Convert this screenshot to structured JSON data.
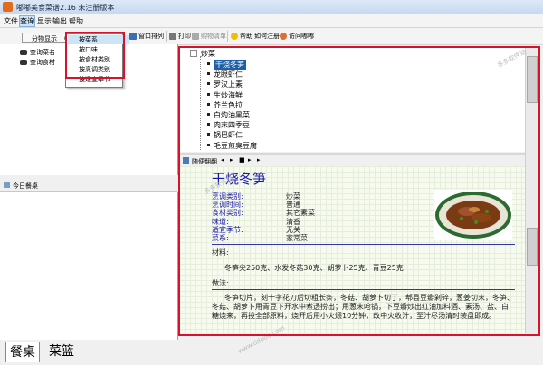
{
  "window": {
    "title": "嘟嘟美食菜谱2.16 未注册版本"
  },
  "menu": {
    "items": [
      "文件",
      "查询",
      "显示",
      "输出",
      "帮助"
    ]
  },
  "query_submenu": {
    "label": "分物显示"
  },
  "dropdown": {
    "items": [
      "按菜系",
      "按口味",
      "按食材类别",
      "按烹调类别",
      "按适宜季节"
    ]
  },
  "toolbar": {
    "window_arrange": "窗口排列",
    "print": "打印",
    "shopping_list": "购物清单",
    "help": "帮助",
    "register": "如何注册",
    "visit": "访问嘟嘟"
  },
  "left_panel": {
    "items": [
      "查询菜名",
      "查询食材"
    ],
    "bottom_title": "今日餐桌"
  },
  "tabs": [
    "餐桌",
    "菜篮"
  ],
  "tree": {
    "root": "炒菜",
    "items": [
      "干烧冬笋",
      "龙眼虾仁",
      "罗汉上素",
      "生炒海鲜",
      "芥兰色拉",
      "白灼油黑菜",
      "肉末四季豆",
      "锅巴虾仁",
      "毛豆煎臭豆腐"
    ],
    "selected_index": 0
  },
  "nav": {
    "label": "随便翻翻"
  },
  "recipe": {
    "name": "干烧冬笋",
    "fields": [
      {
        "label": "烹调类别:",
        "value": "炒菜"
      },
      {
        "label": "烹调时间:",
        "value": "普通"
      },
      {
        "label": "食材类别:",
        "value": "其它素菜"
      },
      {
        "label": "味道:",
        "value": "清香"
      },
      {
        "label": "适宜季节:",
        "value": "无关"
      },
      {
        "label": "菜系:",
        "value": "家常菜"
      }
    ],
    "ingredients_title": "材料:",
    "ingredients": "冬笋尖250克、水发冬菇30克、胡萝卜25克、青豆25克",
    "method_title": "做法:",
    "method": "冬笋切片，刻十字花刀后切粗长条，冬菇、胡萝卜切丁，郫县豆瓣剁碎，葱姜切末，冬笋、冬菇、胡萝卜用青豆下开水中煮透捞出；用葱末呛锅，下豆瓣炒出红油加料酒、素汤、盐、白糖烧来，再投全部原料，烧开后用小火煨10分钟，改中火收汁，至汁尽汤清时装盘即成。"
  },
  "watermarks": [
    "多多软件站",
    "www.ddooo.com"
  ],
  "colors": {
    "accent_red": "#d8122a",
    "title_blue": "#1a1aa8",
    "selection": "#1d5fa8"
  }
}
